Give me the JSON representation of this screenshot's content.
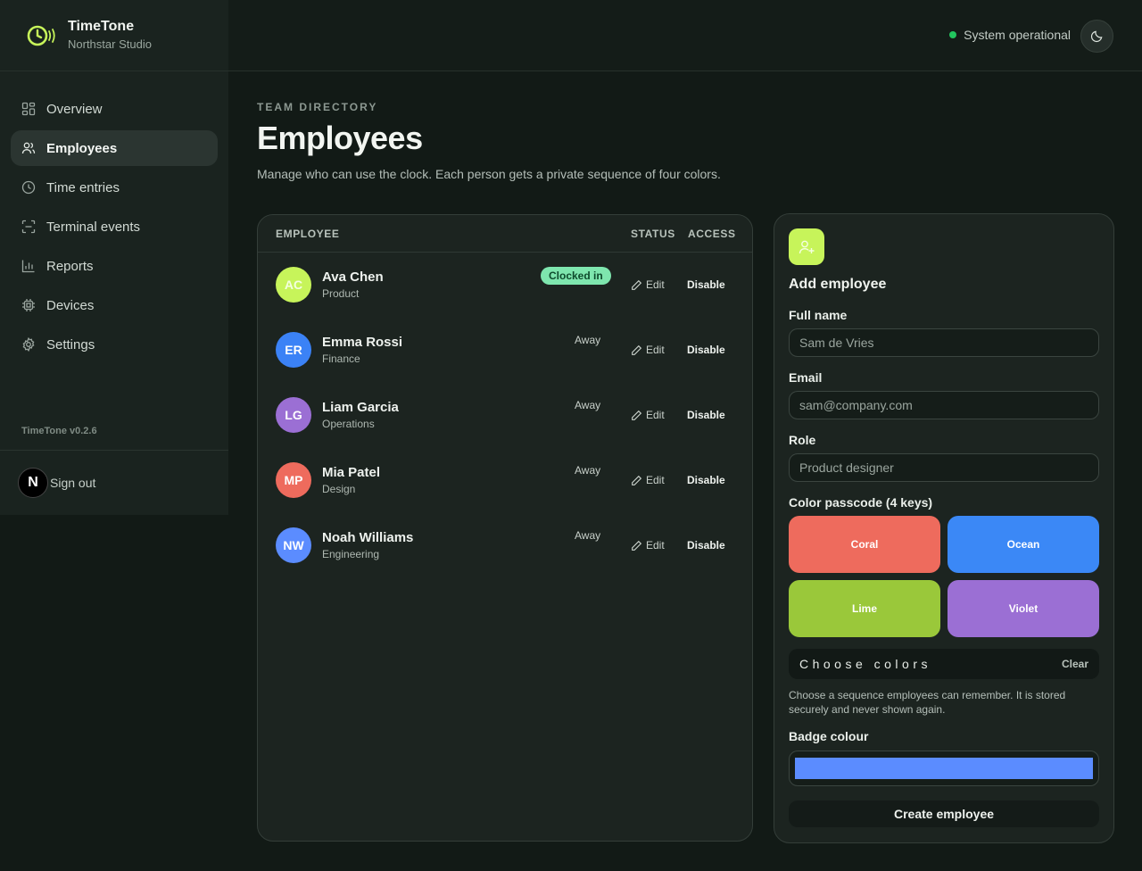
{
  "brand": {
    "name": "TimeTone",
    "org": "Northstar Studio"
  },
  "nav": {
    "items": [
      {
        "label": "Overview",
        "icon": "overview-icon"
      },
      {
        "label": "Employees",
        "icon": "users-icon",
        "active": true
      },
      {
        "label": "Time entries",
        "icon": "clock-icon"
      },
      {
        "label": "Terminal events",
        "icon": "scan-icon"
      },
      {
        "label": "Reports",
        "icon": "chart-icon"
      },
      {
        "label": "Devices",
        "icon": "chip-icon"
      },
      {
        "label": "Settings",
        "icon": "gear-icon"
      }
    ],
    "version": "TimeTone v0.2.6",
    "signout_label": "Sign out",
    "signout_avatar": "N"
  },
  "topbar": {
    "status_text": "System operational",
    "status_color": "#22c55e"
  },
  "header": {
    "eyebrow": "TEAM DIRECTORY",
    "title": "Employees",
    "description": "Manage who can use the clock. Each person gets a private sequence of four colors."
  },
  "table": {
    "columns": {
      "employee": "EMPLOYEE",
      "status": "STATUS",
      "access": "ACCESS"
    },
    "edit_label": "Edit",
    "disable_label": "Disable",
    "rows": [
      {
        "initials": "AC",
        "name": "Ava Chen",
        "role": "Product",
        "status": "Clocked in",
        "color": "#c7f45a"
      },
      {
        "initials": "ER",
        "name": "Emma Rossi",
        "role": "Finance",
        "status": "Away",
        "color": "#3b82f6"
      },
      {
        "initials": "LG",
        "name": "Liam Garcia",
        "role": "Operations",
        "status": "Away",
        "color": "#9b6fd4"
      },
      {
        "initials": "MP",
        "name": "Mia Patel",
        "role": "Design",
        "status": "Away",
        "color": "#ee6b5d"
      },
      {
        "initials": "NW",
        "name": "Noah Williams",
        "role": "Engineering",
        "status": "Away",
        "color": "#5b8cff"
      }
    ]
  },
  "form": {
    "title": "Add employee",
    "full_name": {
      "label": "Full name",
      "placeholder": "Sam de Vries"
    },
    "email": {
      "label": "Email",
      "placeholder": "sam@company.com"
    },
    "role": {
      "label": "Role",
      "placeholder": "Product designer"
    },
    "passcode_label": "Color passcode (4 keys)",
    "colors": [
      {
        "label": "Coral",
        "color": "#ee6b5d"
      },
      {
        "label": "Ocean",
        "color": "#3b88f6"
      },
      {
        "label": "Lime",
        "color": "#9ac83a"
      },
      {
        "label": "Violet",
        "color": "#9b6fd4"
      }
    ],
    "sequence_placeholder": "Choose colors",
    "clear_label": "Clear",
    "help_text": "Choose a sequence employees can remember. It is stored securely and never shown again.",
    "badge_label": "Badge colour",
    "badge_color": "#5b8cff",
    "submit_label": "Create employee"
  }
}
